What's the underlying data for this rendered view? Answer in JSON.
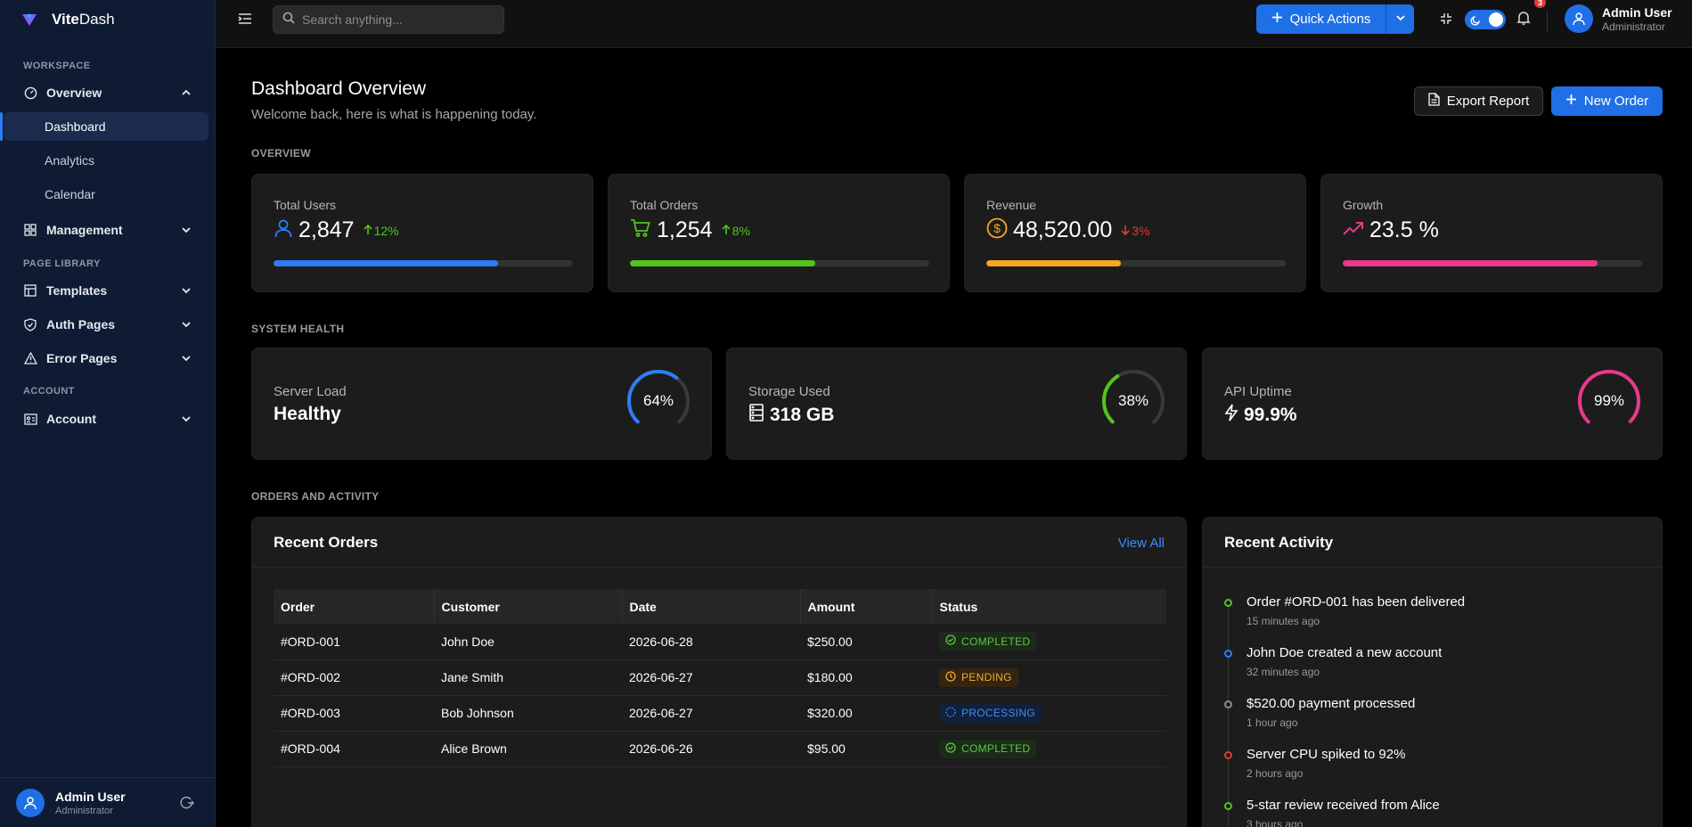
{
  "brand": {
    "prefix": "Vite",
    "suffix": "Dash"
  },
  "sidebar": {
    "sections": {
      "workspace": "WORKSPACE",
      "page_library": "PAGE LIBRARY",
      "account": "ACCOUNT"
    },
    "overview": "Overview",
    "sub_items": [
      "Dashboard",
      "Analytics",
      "Calendar"
    ],
    "management": "Management",
    "templates": "Templates",
    "auth_pages": "Auth Pages",
    "error_pages": "Error Pages",
    "account": "Account",
    "user": {
      "name": "Admin User",
      "role": "Administrator"
    }
  },
  "topbar": {
    "search_placeholder": "Search anything...",
    "quick_actions": "Quick Actions",
    "notifications_count": "3",
    "user": {
      "name": "Admin User",
      "role": "Administrator"
    }
  },
  "header": {
    "title": "Dashboard Overview",
    "subtitle": "Welcome back, here is what is happening today.",
    "export_label": "Export Report",
    "new_order_label": "New Order"
  },
  "sections": {
    "overview": "OVERVIEW",
    "system_health": "SYSTEM HEALTH",
    "orders_activity": "ORDERS AND ACTIVITY"
  },
  "stats": [
    {
      "label": "Total Users",
      "value": "2,847",
      "change": "12%",
      "direction": "up",
      "progress": 0.75,
      "color": "#2f7cf6",
      "icon": "user-icon"
    },
    {
      "label": "Total Orders",
      "value": "1,254",
      "change": "8%",
      "direction": "up",
      "progress": 0.62,
      "color": "#52c41a",
      "icon": "cart-icon"
    },
    {
      "label": "Revenue",
      "value": "48,520.00",
      "change": "3%",
      "direction": "down",
      "progress": 0.45,
      "color": "#f5a623",
      "icon": "dollar-icon"
    },
    {
      "label": "Growth",
      "value": "23.5 %",
      "change": "",
      "direction": "",
      "progress": 0.85,
      "color": "#e8398b",
      "icon": "trend-up-icon"
    }
  ],
  "health": [
    {
      "label": "Server Load",
      "value": "Healthy",
      "gauge": "64%",
      "percent": 64,
      "color": "#2f7cf6"
    },
    {
      "label": "Storage Used",
      "value": "318 GB",
      "gauge": "38%",
      "percent": 38,
      "color": "#52c41a"
    },
    {
      "label": "API Uptime",
      "value": "99.9%",
      "gauge": "99%",
      "percent": 99,
      "color": "#e8398b"
    }
  ],
  "orders": {
    "title": "Recent Orders",
    "view_all": "View All",
    "columns": [
      "Order",
      "Customer",
      "Date",
      "Amount",
      "Status"
    ],
    "rows": [
      {
        "order": "#ORD-001",
        "customer": "John Doe",
        "date": "2026-06-28",
        "amount": "$250.00",
        "status": "COMPLETED"
      },
      {
        "order": "#ORD-002",
        "customer": "Jane Smith",
        "date": "2026-06-27",
        "amount": "$180.00",
        "status": "PENDING"
      },
      {
        "order": "#ORD-003",
        "customer": "Bob Johnson",
        "date": "2026-06-27",
        "amount": "$320.00",
        "status": "PROCESSING"
      },
      {
        "order": "#ORD-004",
        "customer": "Alice Brown",
        "date": "2026-06-26",
        "amount": "$95.00",
        "status": "COMPLETED"
      }
    ]
  },
  "activity": {
    "title": "Recent Activity",
    "items": [
      {
        "text": "Order #ORD-001 has been delivered",
        "time": "15 minutes ago",
        "color": "#52c41a"
      },
      {
        "text": "John Doe created a new account",
        "time": "32 minutes ago",
        "color": "#2f7cf6"
      },
      {
        "text": "$520.00 payment processed",
        "time": "1 hour ago",
        "color": "#8c8c8c"
      },
      {
        "text": "Server CPU spiked to 92%",
        "time": "2 hours ago",
        "color": "#e53935"
      },
      {
        "text": "5-star review received from Alice",
        "time": "3 hours ago",
        "color": "#52c41a"
      }
    ]
  }
}
